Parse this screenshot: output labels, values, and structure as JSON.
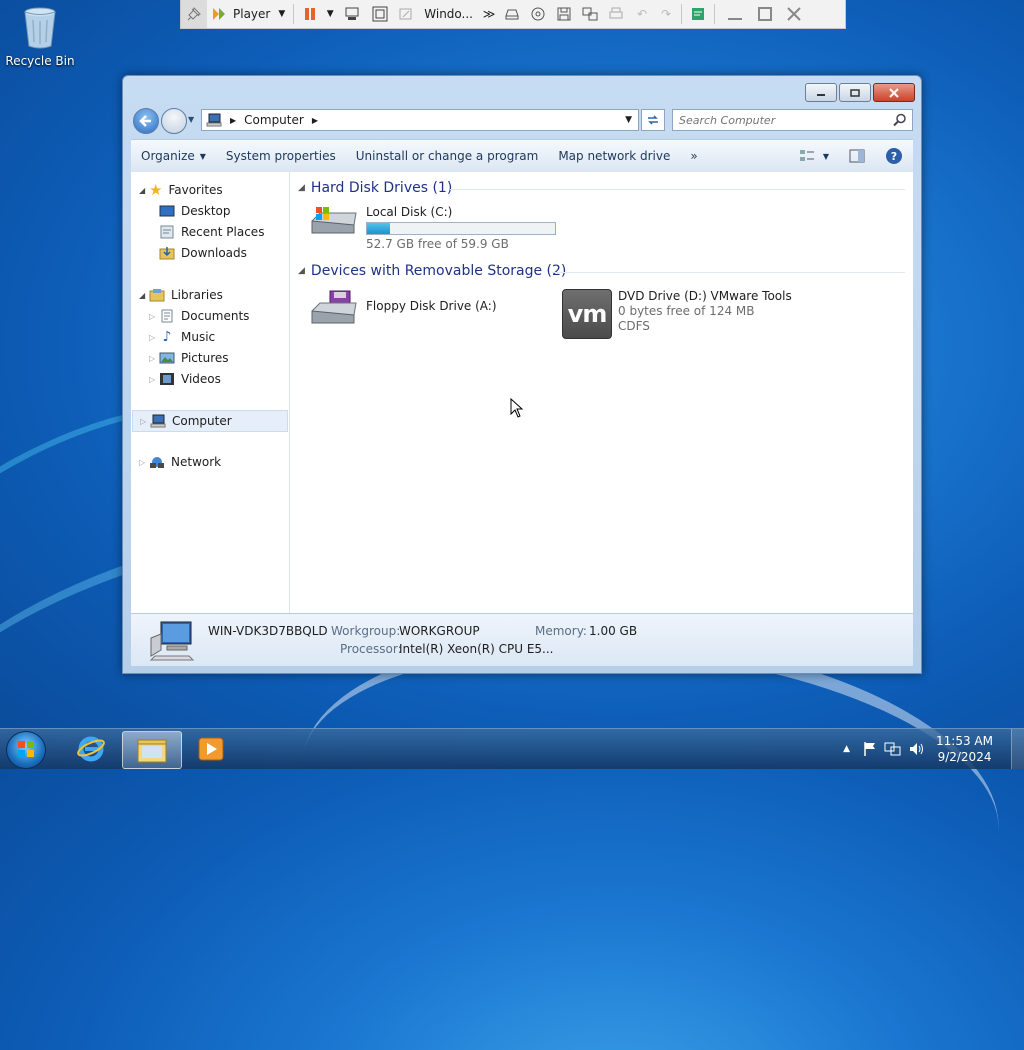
{
  "desktop": {
    "recycle_bin_label": "Recycle Bin"
  },
  "vmware_toolbar": {
    "player_label": "Player",
    "windows_label": "Windo...",
    "icons": [
      "pin-icon",
      "player-icon",
      "pause-icon",
      "send-cad-icon",
      "fullscreen-icon",
      "unity-icon",
      "windows-icon",
      "more-icon",
      "removable-device-icon",
      "cd-icon",
      "floppy-icon",
      "network-icon",
      "printer-icon",
      "back-icon",
      "forward-icon",
      "notes-icon",
      "minimize-icon",
      "restore-icon",
      "close-icon"
    ]
  },
  "explorer": {
    "address": {
      "path": "Computer"
    },
    "search": {
      "placeholder": "Search Computer"
    },
    "commands": {
      "organize": "Organize",
      "system_properties": "System properties",
      "uninstall": "Uninstall or change a program",
      "map_drive": "Map network drive",
      "more": "»"
    },
    "nav": {
      "favorites": "Favorites",
      "desktop": "Desktop",
      "recent": "Recent Places",
      "downloads": "Downloads",
      "libraries": "Libraries",
      "documents": "Documents",
      "music": "Music",
      "pictures": "Pictures",
      "videos": "Videos",
      "computer": "Computer",
      "network": "Network"
    },
    "groups": {
      "hdd": "Hard Disk Drives (1)",
      "removable": "Devices with Removable Storage (2)"
    },
    "drives": {
      "c": {
        "name": "Local Disk (C:)",
        "free": "52.7 GB free of 59.9 GB",
        "used_fraction": 0.12
      },
      "a": {
        "name": "Floppy Disk Drive (A:)"
      },
      "d": {
        "name": "DVD Drive (D:) VMware Tools",
        "free": "0 bytes free of 124 MB",
        "fs": "CDFS",
        "logo": "vm"
      }
    },
    "details": {
      "computer_name": "WIN-VDK3D7BBQLD",
      "workgroup_label": "Workgroup:",
      "workgroup": "WORKGROUP",
      "memory_label": "Memory:",
      "memory": "1.00 GB",
      "processor_label": "Processor:",
      "processor": "Intel(R) Xeon(R) CPU E5..."
    }
  },
  "taskbar": {
    "time": "11:53 AM",
    "date": "9/2/2024"
  },
  "colors": {
    "accent": "#1e3287",
    "disk_fill": "#1e93cc"
  }
}
